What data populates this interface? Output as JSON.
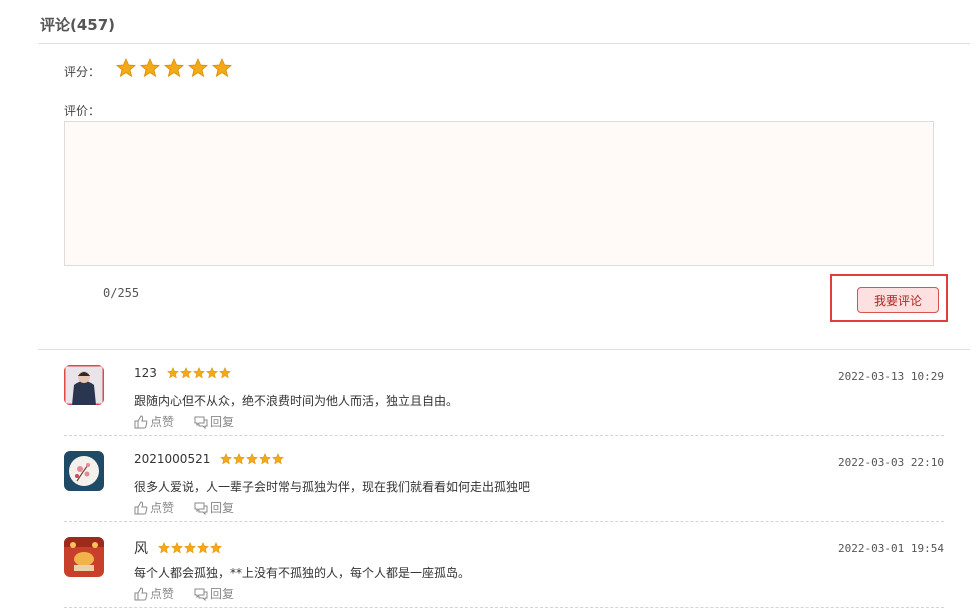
{
  "header": {
    "title": "评论(457)"
  },
  "form": {
    "rating_label": "评分：",
    "rating_value": 5,
    "rating_max": 5,
    "review_label": "评价：",
    "review_value": "",
    "counter": "0/255",
    "submit_label": "我要评论"
  },
  "colors": {
    "star": "#f4a916",
    "accent": "#d9534f",
    "highlight": "#e03e3e"
  },
  "comments": [
    {
      "user": "123",
      "stars": 5,
      "time": "2022-03-13 10:29",
      "text": "跟随内心但不从众，绝不浪费时间为他人而活，独立且自由。",
      "like_label": "点赞",
      "reply_label": "回复",
      "avatar": "person-avatar"
    },
    {
      "user": "2021000521",
      "stars": 5,
      "time": "2022-03-03 22:10",
      "text": "很多人爱说，人一辈子会时常与孤独为伴，现在我们就看看如何走出孤独吧",
      "like_label": "点赞",
      "reply_label": "回复",
      "avatar": "flower-avatar"
    },
    {
      "user": "风",
      "stars": 5,
      "time": "2022-03-01 19:54",
      "text": "每个人都会孤独，**上没有不孤独的人，每个人都是一座孤岛。",
      "like_label": "点赞",
      "reply_label": "回复",
      "avatar": "lantern-avatar"
    }
  ]
}
